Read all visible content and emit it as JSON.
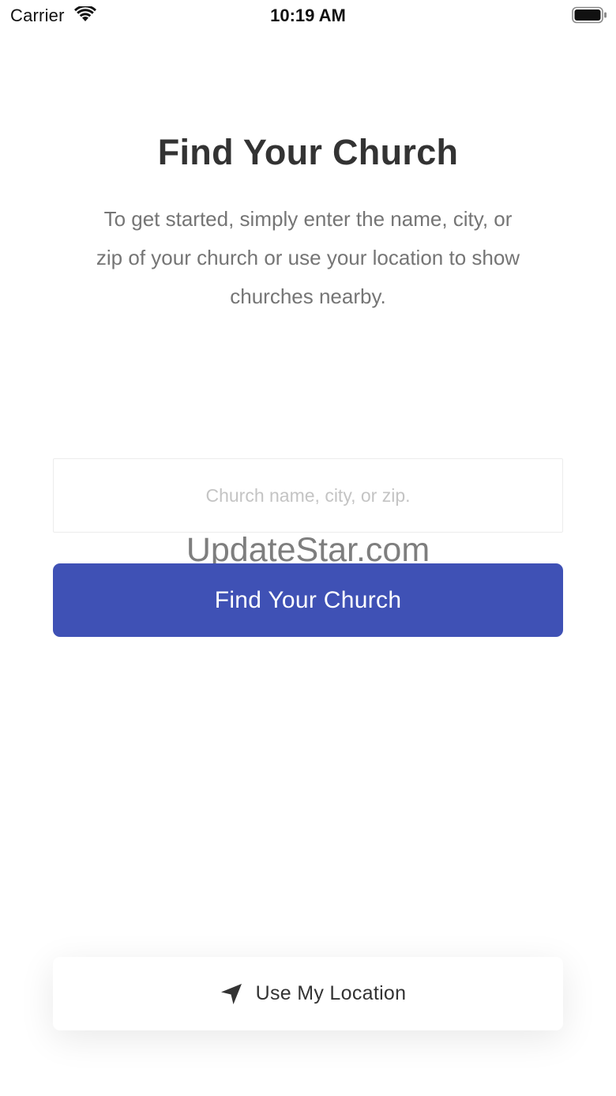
{
  "status_bar": {
    "carrier": "Carrier",
    "time": "10:19 AM",
    "wifi_icon": "wifi-icon",
    "battery_icon": "battery-icon"
  },
  "header": {
    "title": "Find Your Church",
    "description": "To get started, simply enter the name, city, or zip of your church or use your location to show churches nearby."
  },
  "search": {
    "value": "",
    "placeholder": "Church name, city, or zip."
  },
  "watermark": "UpdateStar.com",
  "primary_button": {
    "label": "Find Your Church"
  },
  "location_button": {
    "label": "Use My Location",
    "icon": "location-arrow-icon"
  },
  "colors": {
    "accent": "#3f51b5",
    "title_text": "#333333",
    "body_text": "#757575",
    "placeholder": "#c4c4c4"
  }
}
